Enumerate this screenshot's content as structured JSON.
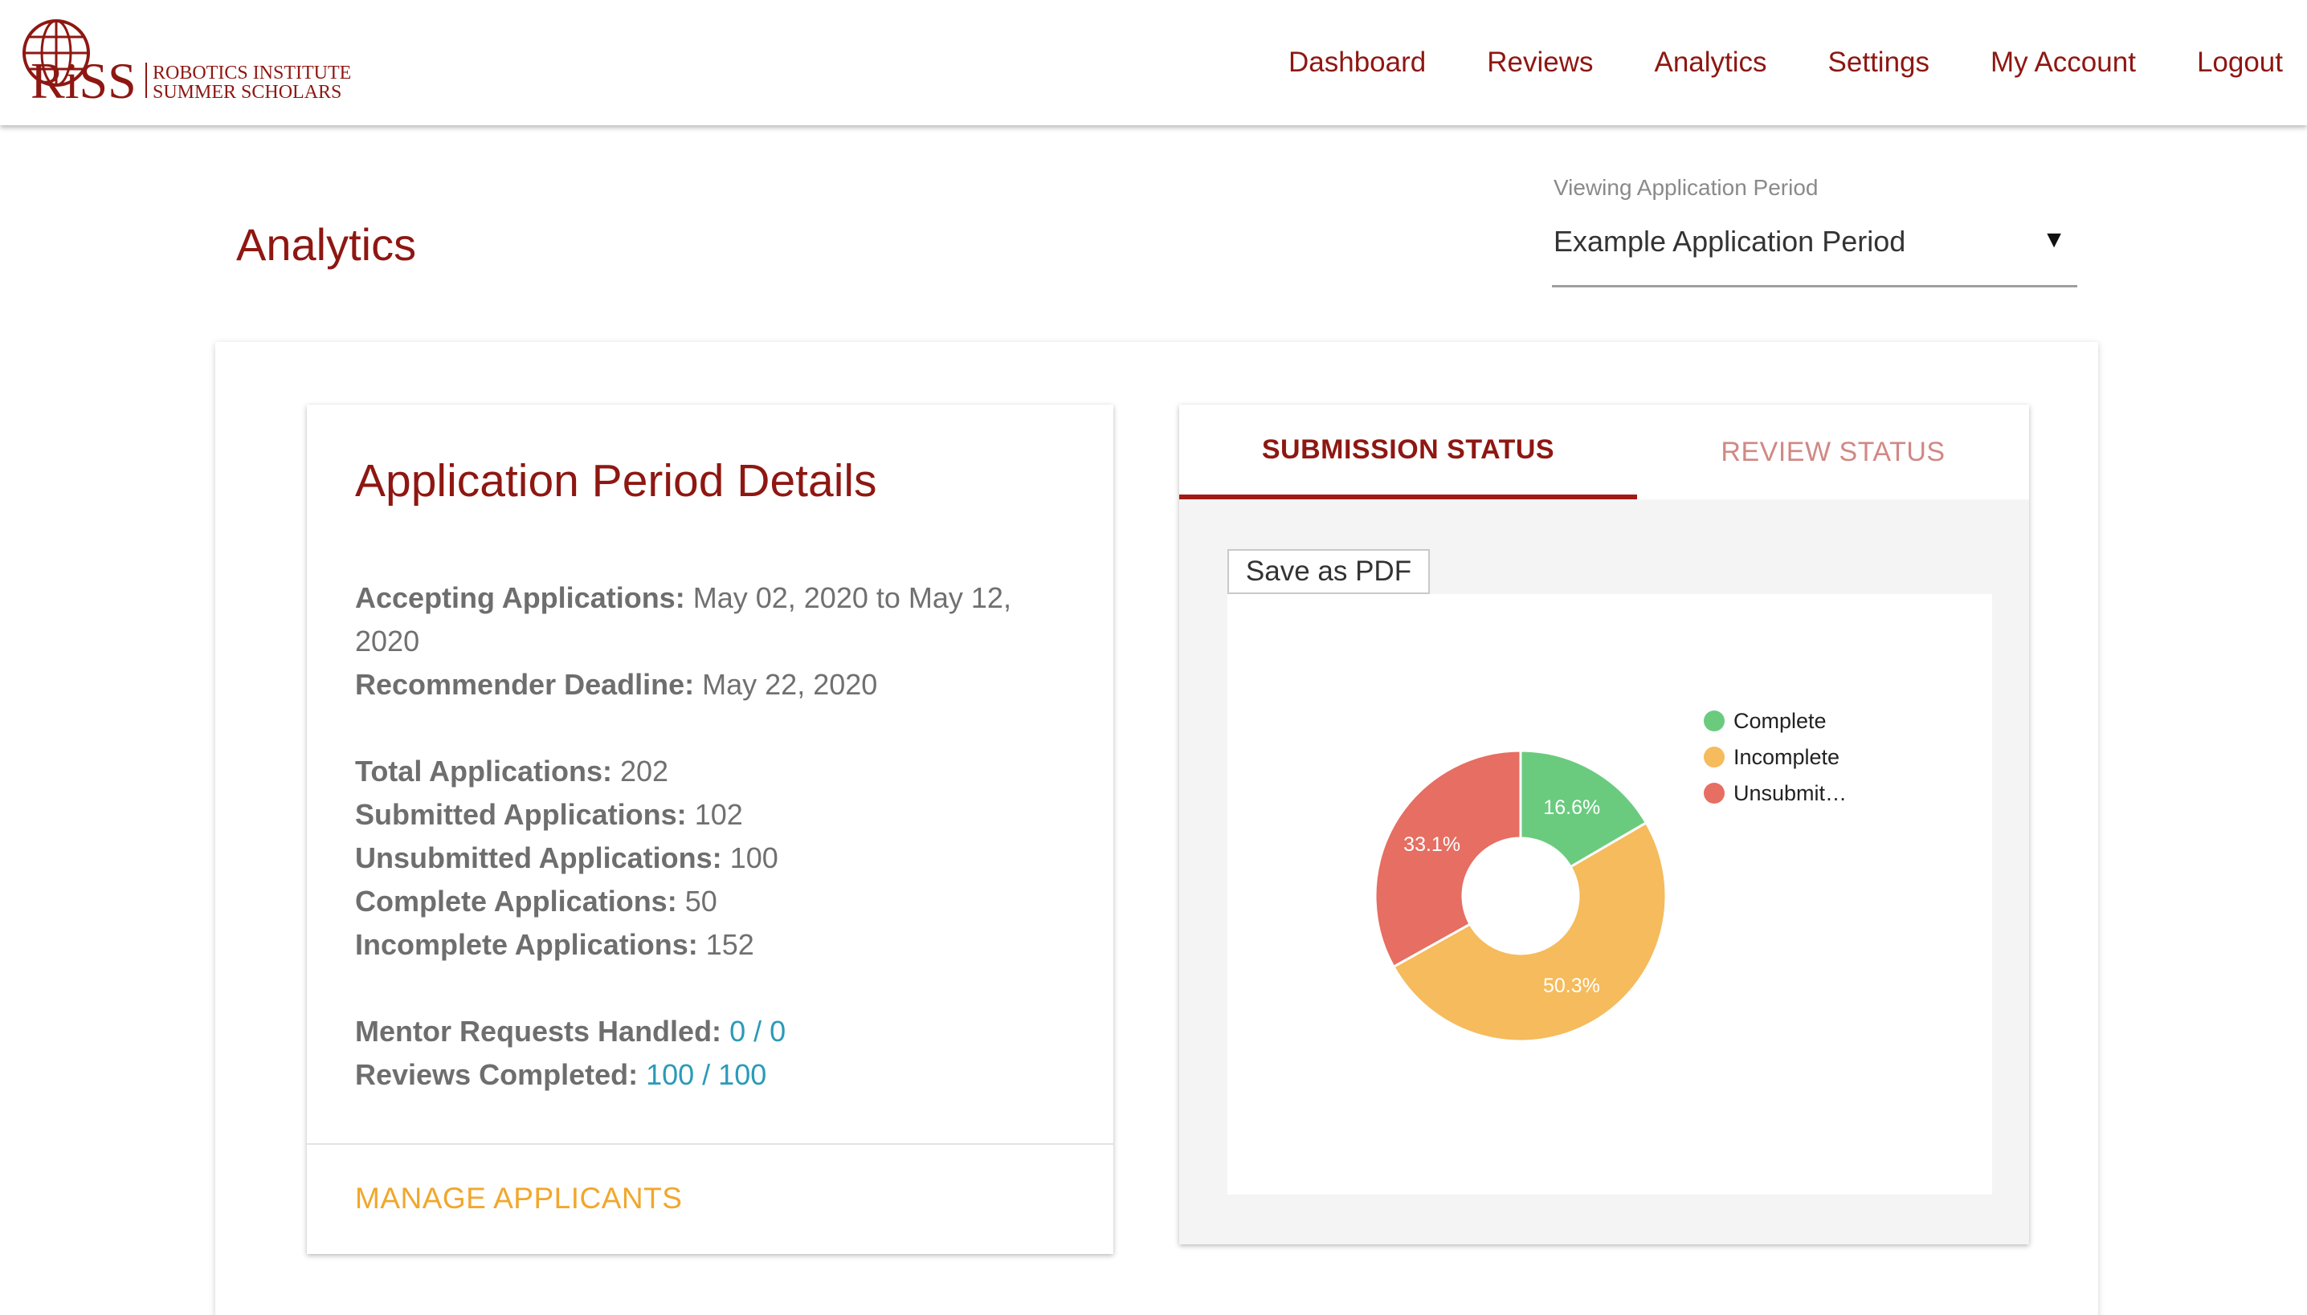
{
  "logo": {
    "mark": "RiSS",
    "line1": "ROBOTICS INSTITUTE",
    "line2": "SUMMER SCHOLARS"
  },
  "nav": {
    "dashboard": "Dashboard",
    "reviews": "Reviews",
    "analytics": "Analytics",
    "settings": "Settings",
    "my_account": "My Account",
    "logout": "Logout"
  },
  "page": {
    "title": "Analytics"
  },
  "period_select": {
    "label": "Viewing Application Period",
    "value": "Example Application Period",
    "arrow": "▼"
  },
  "details": {
    "title": "Application Period Details",
    "accepting_label": "Accepting Applications:",
    "accepting_value": "May 02, 2020 to May 12, 2020",
    "recommender_label": "Recommender Deadline:",
    "recommender_value": "May 22, 2020",
    "total_label": "Total Applications:",
    "total_value": "202",
    "submitted_label": "Submitted Applications:",
    "submitted_value": "102",
    "unsubmitted_label": "Unsubmitted Applications:",
    "unsubmitted_value": "100",
    "complete_label": "Complete Applications:",
    "complete_value": "50",
    "incomplete_label": "Incomplete Applications:",
    "incomplete_value": "152",
    "mentor_label": "Mentor Requests Handled:",
    "mentor_value": "0 / 0",
    "reviews_label": "Reviews Completed:",
    "reviews_value": "100 / 100",
    "manage_button": "MANAGE APPLICANTS"
  },
  "status": {
    "tabs": {
      "submission": "SUBMISSION STATUS",
      "review": "REVIEW STATUS"
    },
    "save_pdf": "Save as PDF"
  },
  "colors": {
    "brand": "#8e1712",
    "complete": "#6acb7f",
    "incomplete": "#f5bb5c",
    "unsubmitted": "#e66e62",
    "link": "#2b9ab8",
    "manage": "#f1a72c"
  },
  "chart_data": {
    "type": "pie",
    "donut": true,
    "categories": [
      "Complete",
      "Incomplete",
      "Unsubmit…"
    ],
    "values": [
      16.6,
      50.3,
      33.1
    ],
    "labels": [
      "16.6%",
      "50.3%",
      "33.1%"
    ],
    "colors": [
      "#6acb7f",
      "#f5bb5c",
      "#e66e62"
    ],
    "legend_position": "right"
  }
}
